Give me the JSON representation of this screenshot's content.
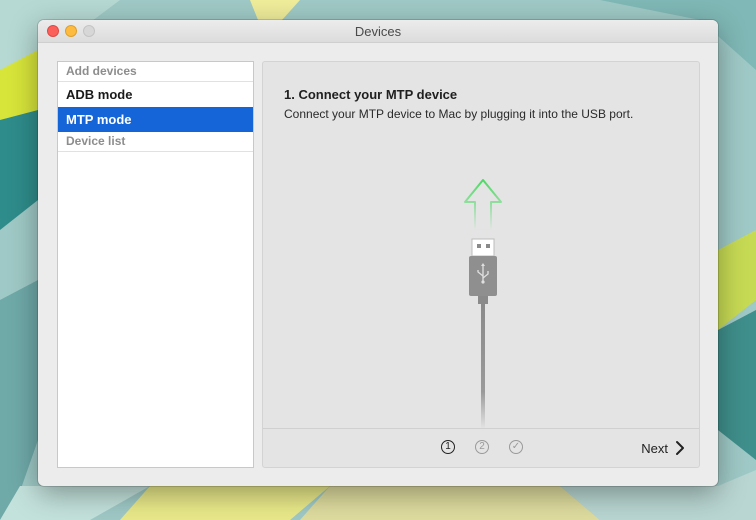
{
  "window": {
    "title": "Devices"
  },
  "sidebar": {
    "sections": [
      {
        "header": "Add devices",
        "items": [
          "ADB mode",
          "MTP mode"
        ]
      },
      {
        "header": "Device list",
        "items": []
      }
    ],
    "selected": "MTP mode"
  },
  "step": {
    "title": "1. Connect your MTP device",
    "description": "Connect your MTP device to Mac by plugging it into the USB port."
  },
  "progress": {
    "steps": [
      "1",
      "2",
      "✓"
    ],
    "current": 1
  },
  "footer": {
    "next_label": "Next"
  },
  "colors": {
    "accent": "#1565d8",
    "arrow": "#4cd964",
    "cable": "#8a8a8a"
  },
  "icons": [
    "usb-icon",
    "chevron-right-icon",
    "check-icon"
  ]
}
